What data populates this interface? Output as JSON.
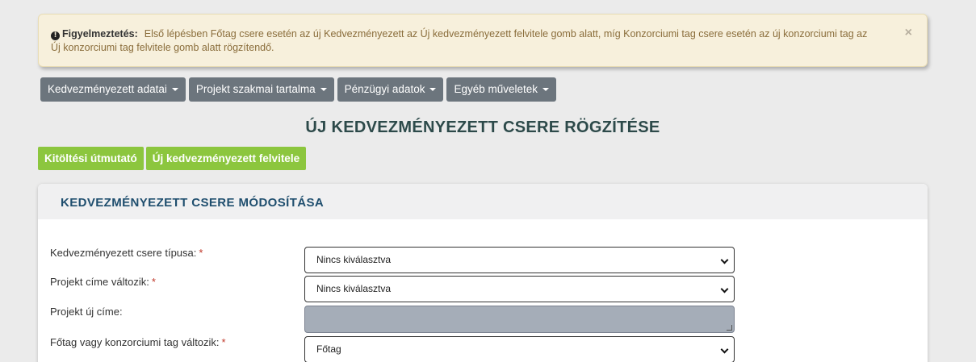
{
  "alert": {
    "title": "Figyelmeztetés:",
    "message": "Első lépésben Főtag csere esetén az új Kedvezményezett az Új kedvezményezett felvitele gomb alatt, míg Konzorciumi tag csere esetén az új konzorciumi tag az Új konzorciumi tag felvitele gomb alatt rögzítendő.",
    "close": "×",
    "icon_glyph": "!"
  },
  "menu": [
    {
      "label": "Kedvezményezett adatai"
    },
    {
      "label": "Projekt szakmai tartalma"
    },
    {
      "label": "Pénzügyi adatok"
    },
    {
      "label": "Egyéb műveletek"
    }
  ],
  "page_title": "ÚJ KEDVEZMÉNYEZETT CSERE RÖGZÍTÉSE",
  "actions": {
    "guide": "Kitöltési útmutató",
    "add_new": "Új kedvezményezett felvitele"
  },
  "card": {
    "title": "KEDVEZMÉNYEZETT CSERE MÓDOSÍTÁSA",
    "fields": [
      {
        "label": "Kedvezményezett csere típusa:",
        "required": "*",
        "type": "select",
        "value": "Nincs kiválasztva"
      },
      {
        "label": "Projekt címe változik:",
        "required": "*",
        "type": "select",
        "value": "Nincs kiválasztva"
      },
      {
        "label": "Projekt új címe:",
        "type": "textarea",
        "value": ""
      },
      {
        "label": "Főtag vagy konzorciumi tag változik:",
        "required": "*",
        "type": "select",
        "value": "Főtag"
      }
    ]
  },
  "colors": {
    "alert_bg": "#f7f0dc",
    "menu_bg": "#6c757d",
    "green": "#8cc63e",
    "card_title": "#1f4e6e",
    "page_title": "#2d4a4a"
  }
}
